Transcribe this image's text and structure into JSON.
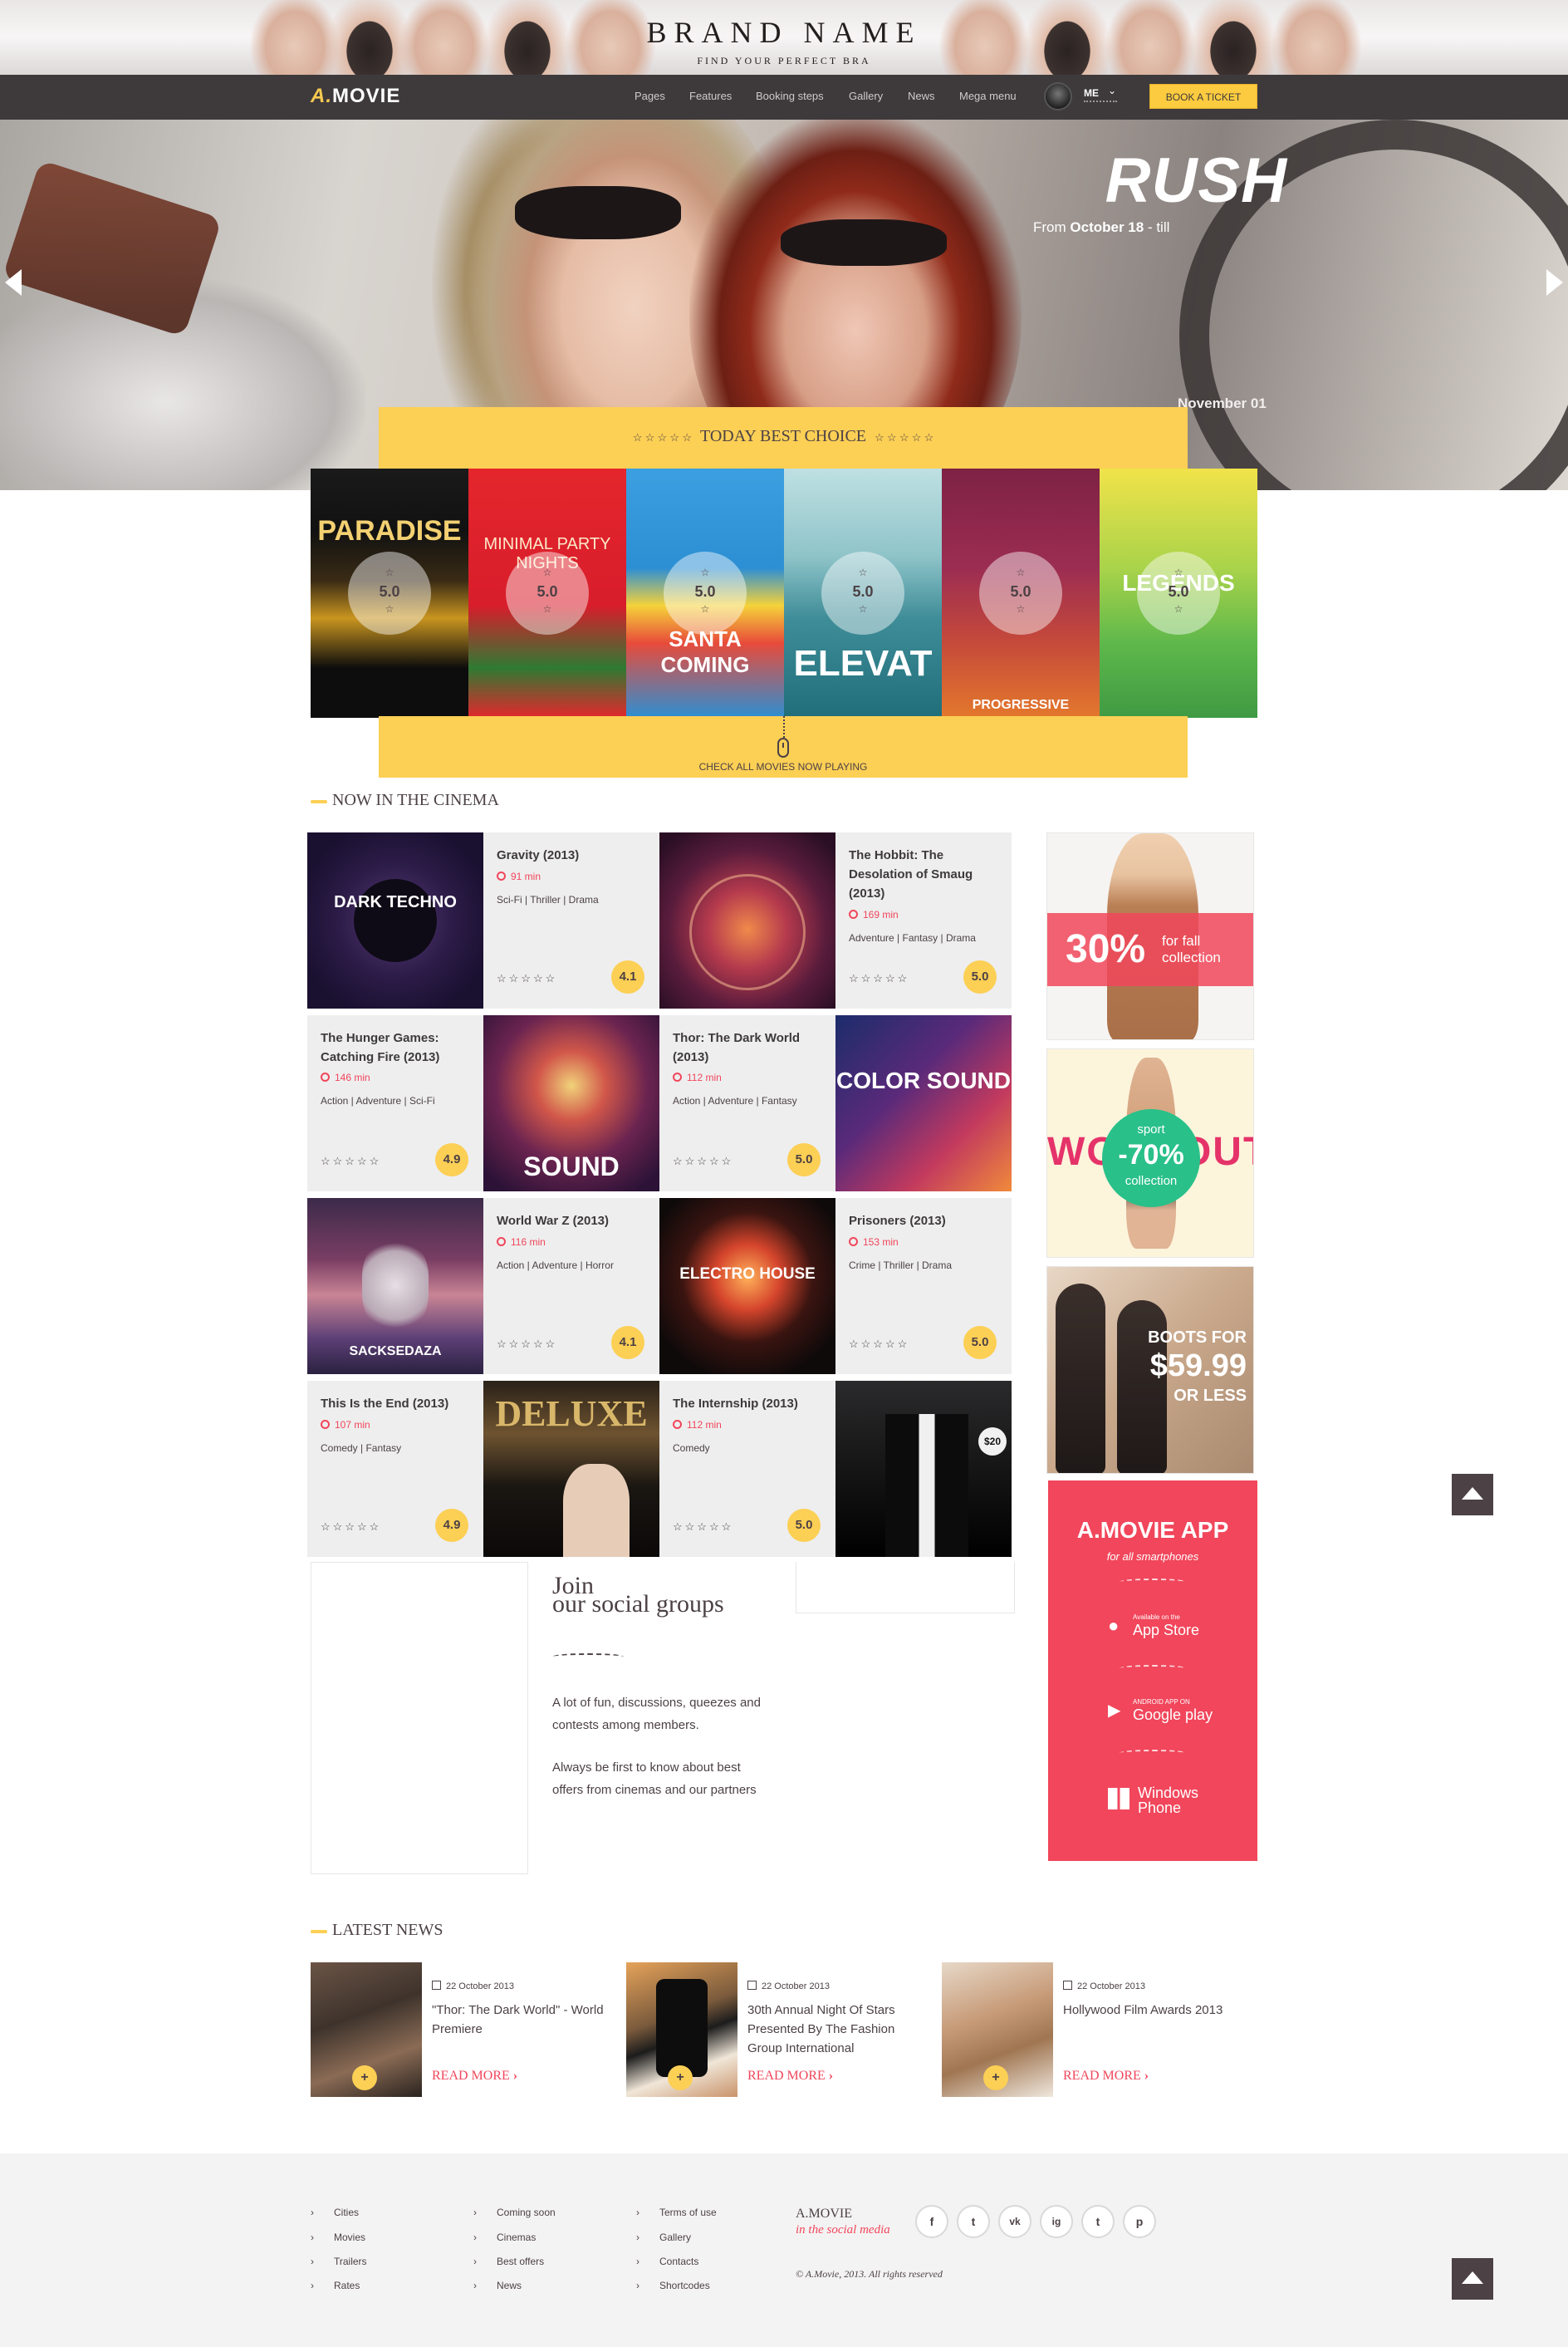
{
  "banner": {
    "brand_name": "BRAND NAME",
    "tagline": "FIND YOUR PERFECT BRA"
  },
  "nav": {
    "logo_a": "A.",
    "logo_text": "MOVIE",
    "items": [
      "Pages",
      "Features",
      "Booking steps",
      "Gallery",
      "News",
      "Mega menu"
    ],
    "user_label": "ME",
    "book_button": "BOOK A TICKET"
  },
  "hero": {
    "title": "RUSH",
    "from_prefix": "From",
    "from_date": "October 18",
    "from_suffix": "- till",
    "end_date": "November 01"
  },
  "best_choice": {
    "title": "TODAY BEST CHOICE",
    "stars_left": "☆ ☆ ☆ ☆ ☆",
    "stars_right": "☆ ☆ ☆ ☆ ☆",
    "link": "CHECK ALL MOVIES NOW PLAYING",
    "posters": [
      {
        "rating": "5.0",
        "star": "☆",
        "text": "PARADISE",
        "color_a": "#111111",
        "color_b": "#c9951f"
      },
      {
        "rating": "5.0",
        "star": "☆",
        "text": "MINIMAL PARTY NIGHTS",
        "color_a": "#e4262c",
        "color_b": "#3b8a3a"
      },
      {
        "rating": "5.0",
        "star": "☆",
        "text": "SANTA COMING",
        "color_a": "#2d8fd3",
        "color_b": "#e84b3a"
      },
      {
        "rating": "5.0",
        "star": "☆",
        "text": "ELEVAT",
        "color_a": "#8fc4c9",
        "color_b": "#1f6e7a"
      },
      {
        "rating": "5.0",
        "star": "☆",
        "text": "PROGRESSIVE",
        "color_a": "#9c2d52",
        "color_b": "#e3782d"
      },
      {
        "rating": "5.0",
        "star": "☆",
        "text": "LEGENDS",
        "color_a": "#5fb84b",
        "color_b": "#e6d33b"
      }
    ]
  },
  "cinema": {
    "heading": "NOW IN THE CINEMA",
    "stars": "☆☆☆☆☆",
    "movies": [
      {
        "title": "Gravity (2013)",
        "time": "91 min",
        "genre": "Sci-Fi | Thriller | Drama",
        "score": "4.1",
        "poster": "DARK TECHNO"
      },
      {
        "title": "The Hobbit: The Desolation of Smaug (2013)",
        "time": "169 min",
        "genre": "Adventure | Fantasy | Drama",
        "score": "5.0",
        "poster": ""
      },
      {
        "title": "The Hunger Games: Catching Fire (2013)",
        "time": "146 min",
        "genre": "Action | Adventure | Sci-Fi",
        "score": "4.9",
        "poster": "SOUND"
      },
      {
        "title": "Thor: The Dark World (2013)",
        "time": "112 min",
        "genre": "Action | Adventure | Fantasy",
        "score": "5.0",
        "poster": "COLOR SOUND"
      },
      {
        "title": "World War Z (2013)",
        "time": "116 min",
        "genre": "Action | Adventure | Horror",
        "score": "4.1",
        "poster": "SACKSEDAZA"
      },
      {
        "title": "Prisoners (2013)",
        "time": "153 min",
        "genre": "Crime | Thriller | Drama",
        "score": "5.0",
        "poster": "ELECTRO HOUSE"
      },
      {
        "title": "This Is the End (2013)",
        "time": "107 min",
        "genre": "Comedy | Fantasy",
        "score": "4.9",
        "poster": "DELUXE"
      },
      {
        "title": "The Internship (2013)",
        "time": "112 min",
        "genre": "Comedy",
        "score": "5.0",
        "poster": "$20"
      }
    ]
  },
  "ads": [
    {
      "big": "30%",
      "small": "for fall collection"
    },
    {
      "top": "sport",
      "big": "-70%",
      "bottom": "collection",
      "word": "WORKOUT"
    },
    {
      "line1": "BOOTS FOR",
      "big": "$59.99",
      "line2": "OR LESS"
    }
  ],
  "app": {
    "title": "A.MOVIE APP",
    "subtitle": "for all smartphones",
    "appstore_small": "Available on the",
    "appstore": "App Store",
    "google_small": "ANDROID APP ON",
    "google": "Google play",
    "windows": "Windows",
    "windows2": "Phone"
  },
  "social": {
    "title1": "Join",
    "title2": "our social groups",
    "text1": "A lot of fun, discussions, queezes and contests among members.",
    "text2": "Always be first to know about best offers from cinemas and our partners"
  },
  "news": {
    "heading": "LATEST NEWS",
    "items": [
      {
        "date": "22 October 2013",
        "title": "\"Thor: The Dark World\" - World Premiere",
        "more": "READ MORE"
      },
      {
        "date": "22 October 2013",
        "title": "30th Annual Night Of Stars Presented By The Fashion Group International",
        "more": "READ MORE"
      },
      {
        "date": "22 October 2013",
        "title": "Hollywood Film Awards 2013",
        "more": "READ MORE"
      }
    ]
  },
  "footer": {
    "col1": [
      "Cities",
      "Movies",
      "Trailers",
      "Rates"
    ],
    "col2": [
      "Coming soon",
      "Cinemas",
      "Best offers",
      "News"
    ],
    "col3": [
      "Terms of use",
      "Gallery",
      "Contacts",
      "Shortcodes"
    ],
    "brand": "A.MOVIE",
    "brand_sub": "in the social media",
    "copyright": "© A.Movie, 2013. All rights reserved",
    "social_icons": [
      "f",
      "t",
      "vk",
      "ig",
      "t",
      "p"
    ]
  },
  "colors": {
    "accent_yellow": "#fccf55",
    "accent_red": "#f1465b",
    "dark": "#4c4145"
  }
}
